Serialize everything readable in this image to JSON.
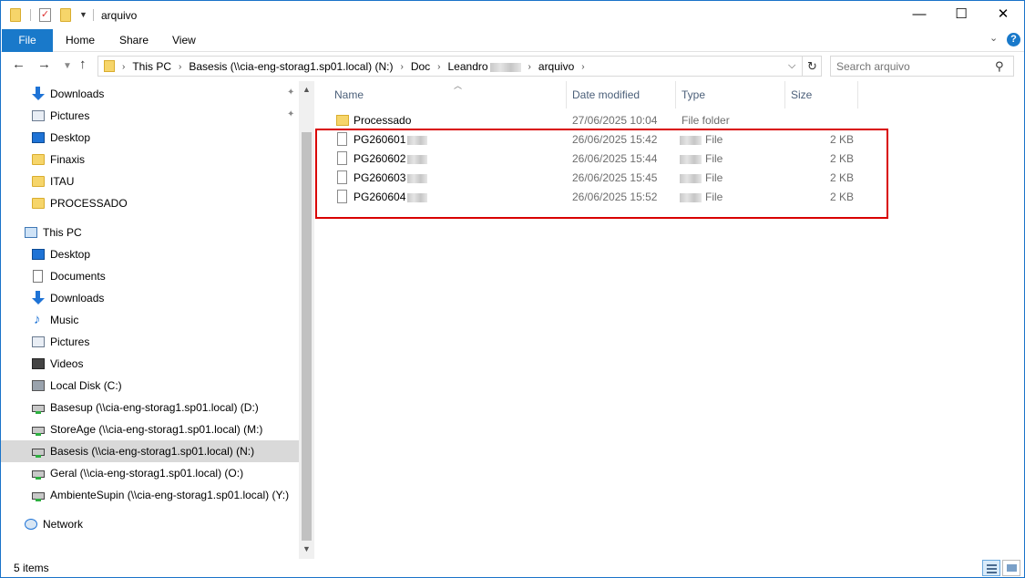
{
  "window": {
    "title": "arquivo",
    "minimize": "—",
    "maximize": "☐",
    "close": "✕"
  },
  "ribbon": {
    "tabs": [
      "File",
      "Home",
      "Share",
      "View"
    ],
    "help": "?"
  },
  "address": {
    "crumbs": [
      "This PC",
      "Basesis (\\\\cia-eng-storag1.sp01.local) (N:)",
      "Doc",
      "Leandro",
      "arquivo"
    ]
  },
  "search": {
    "placeholder": "Search arquivo"
  },
  "sidebar": {
    "quick_access": [
      {
        "label": "Downloads",
        "icon": "download-icon",
        "pinned": true
      },
      {
        "label": "Pictures",
        "icon": "pictures-icon",
        "pinned": true
      },
      {
        "label": "Desktop",
        "icon": "desktop-icon",
        "pinned": false
      },
      {
        "label": "Finaxis",
        "icon": "folder-icon",
        "pinned": false
      },
      {
        "label": "ITAU",
        "icon": "folder-icon",
        "pinned": false
      },
      {
        "label": "PROCESSADO",
        "icon": "folder-icon",
        "pinned": false
      }
    ],
    "this_pc": "This PC",
    "pc_items": [
      {
        "label": "Desktop",
        "icon": "desktop-icon"
      },
      {
        "label": "Documents",
        "icon": "documents-icon"
      },
      {
        "label": "Downloads",
        "icon": "download-icon"
      },
      {
        "label": "Music",
        "icon": "music-icon"
      },
      {
        "label": "Pictures",
        "icon": "pictures-icon"
      },
      {
        "label": "Videos",
        "icon": "videos-icon"
      },
      {
        "label": "Local Disk (C:)",
        "icon": "local-disk-icon"
      },
      {
        "label": "Basesup (\\\\cia-eng-storag1.sp01.local) (D:)",
        "icon": "network-drive-icon"
      },
      {
        "label": "StoreAge (\\\\cia-eng-storag1.sp01.local) (M:)",
        "icon": "network-drive-icon"
      },
      {
        "label": "Basesis (\\\\cia-eng-storag1.sp01.local) (N:)",
        "icon": "network-drive-icon",
        "selected": true
      },
      {
        "label": "Geral (\\\\cia-eng-storag1.sp01.local) (O:)",
        "icon": "network-drive-icon"
      },
      {
        "label": "AmbienteSupin (\\\\cia-eng-storag1.sp01.local) (Y:)",
        "icon": "network-drive-icon"
      }
    ],
    "network": "Network"
  },
  "columns": {
    "name": "Name",
    "date": "Date modified",
    "type": "Type",
    "size": "Size"
  },
  "files": [
    {
      "name": "Processado",
      "date": "27/06/2025 10:04",
      "type": "File folder",
      "size": "",
      "kind": "folder"
    },
    {
      "name": "PG260601",
      "date": "26/06/2025 15:42",
      "type": "File",
      "size": "2 KB",
      "kind": "file"
    },
    {
      "name": "PG260602",
      "date": "26/06/2025 15:44",
      "type": "File",
      "size": "2 KB",
      "kind": "file"
    },
    {
      "name": "PG260603",
      "date": "26/06/2025 15:45",
      "type": "File",
      "size": "2 KB",
      "kind": "file"
    },
    {
      "name": "PG260604",
      "date": "26/06/2025 15:52",
      "type": "File",
      "size": "2 KB",
      "kind": "file"
    }
  ],
  "status": {
    "items": "5 items"
  },
  "colors": {
    "accent": "#1979ca",
    "highlight_box": "#d90000",
    "selected": "#d9d9d9"
  }
}
